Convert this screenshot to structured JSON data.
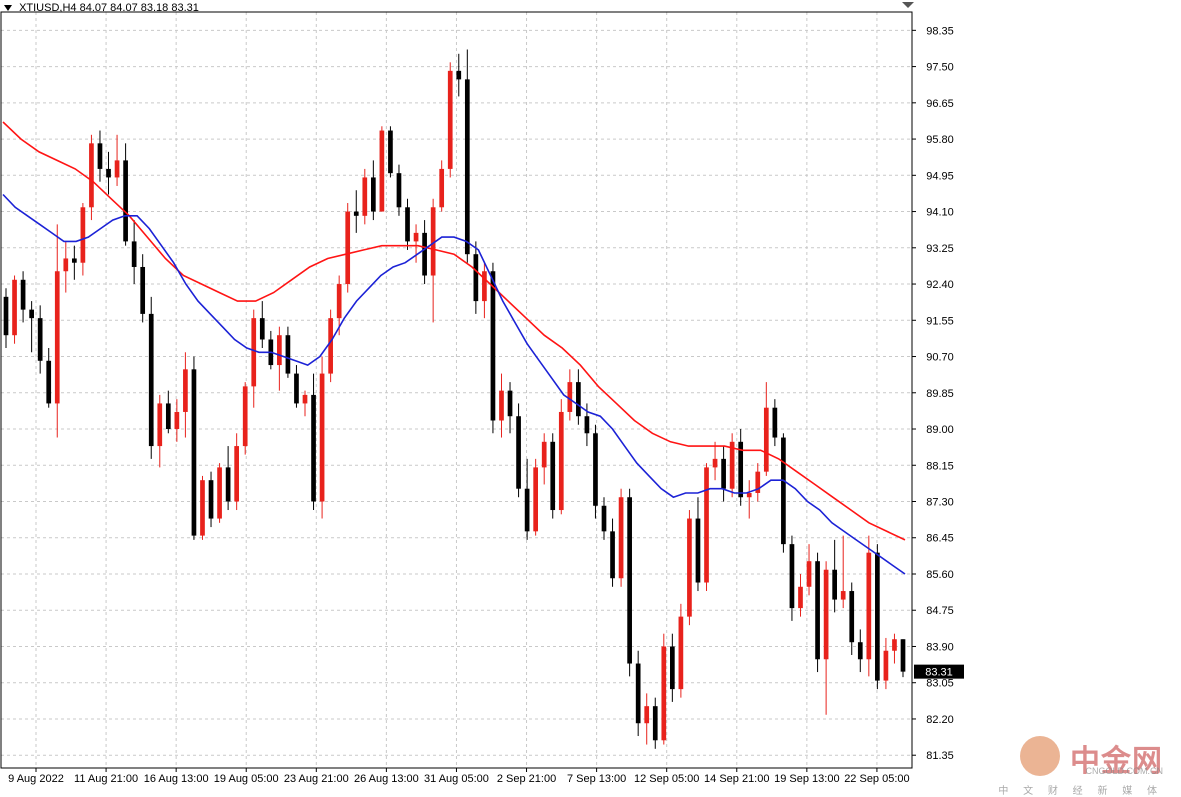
{
  "header": {
    "symbol": "XTIUSD,H4",
    "ohlc": "84.07 84.07 83.18 83.31"
  },
  "watermark": {
    "brand": "中金网",
    "site": "CNGOLD.COM.CN",
    "tagline": "中 文 财 经 新 媒 体"
  },
  "price_tag": "83.31",
  "colors": {
    "bull": "#e8221c",
    "bear": "#000000",
    "ma_fast": "#1c22d6",
    "ma_slow": "#ff1414",
    "grid": "#c9c9c9"
  },
  "chart_data": {
    "type": "candlestick",
    "symbol": "XTIUSD",
    "timeframe": "H4",
    "grid": true,
    "ylim": [
      81.05,
      98.78
    ],
    "y_ticks": [
      "98.35",
      "97.50",
      "96.65",
      "95.80",
      "94.95",
      "94.10",
      "93.25",
      "92.40",
      "91.55",
      "90.70",
      "89.85",
      "89.00",
      "88.15",
      "87.30",
      "86.45",
      "85.60",
      "84.75",
      "83.90",
      "83.05",
      "82.20",
      "81.35"
    ],
    "x_ticks": [
      "9 Aug 2022",
      "11 Aug 21:00",
      "16 Aug 13:00",
      "19 Aug 05:00",
      "23 Aug 21:00",
      "26 Aug 13:00",
      "31 Aug 05:00",
      "2 Sep 21:00",
      "7 Sep 13:00",
      "12 Sep 05:00",
      "14 Sep 21:00",
      "19 Sep 13:00",
      "22 Sep 05:00"
    ],
    "candles": [
      [
        92.1,
        92.3,
        90.9,
        91.2
      ],
      [
        91.2,
        92.6,
        91.0,
        92.5
      ],
      [
        92.5,
        92.7,
        91.5,
        91.8
      ],
      [
        91.8,
        92.0,
        90.8,
        91.6
      ],
      [
        91.6,
        91.9,
        90.3,
        90.6
      ],
      [
        90.6,
        90.9,
        89.5,
        89.6
      ],
      [
        89.6,
        93.8,
        88.8,
        92.7
      ],
      [
        92.7,
        93.4,
        92.2,
        93.0
      ],
      [
        93.0,
        93.3,
        92.5,
        92.9
      ],
      [
        92.9,
        94.3,
        92.6,
        94.2
      ],
      [
        94.2,
        95.9,
        93.9,
        95.7
      ],
      [
        95.7,
        96.0,
        94.8,
        95.1
      ],
      [
        95.1,
        95.5,
        94.5,
        94.9
      ],
      [
        94.9,
        95.9,
        94.7,
        95.3
      ],
      [
        95.3,
        95.7,
        93.3,
        93.4
      ],
      [
        93.4,
        93.9,
        92.4,
        92.8
      ],
      [
        92.8,
        93.1,
        91.5,
        91.7
      ],
      [
        91.7,
        92.1,
        88.3,
        88.6
      ],
      [
        88.6,
        89.8,
        88.1,
        89.6
      ],
      [
        89.6,
        89.9,
        88.9,
        89.0
      ],
      [
        89.0,
        89.7,
        88.7,
        89.4
      ],
      [
        89.4,
        90.8,
        88.8,
        90.4
      ],
      [
        90.4,
        90.7,
        86.4,
        86.5
      ],
      [
        86.5,
        87.9,
        86.4,
        87.8
      ],
      [
        87.8,
        88.0,
        86.7,
        86.9
      ],
      [
        86.9,
        88.2,
        86.8,
        88.1
      ],
      [
        88.1,
        88.6,
        87.1,
        87.3
      ],
      [
        87.3,
        88.9,
        87.1,
        88.6
      ],
      [
        88.6,
        90.1,
        88.4,
        90.0
      ],
      [
        90.0,
        91.8,
        89.5,
        91.6
      ],
      [
        91.6,
        92.0,
        90.9,
        91.1
      ],
      [
        91.1,
        91.3,
        90.4,
        90.5
      ],
      [
        90.5,
        91.4,
        89.9,
        91.2
      ],
      [
        91.2,
        91.4,
        90.2,
        90.3
      ],
      [
        90.3,
        90.5,
        89.5,
        89.6
      ],
      [
        89.6,
        89.9,
        89.3,
        89.8
      ],
      [
        89.8,
        90.3,
        87.1,
        87.3
      ],
      [
        87.3,
        90.7,
        86.9,
        90.3
      ],
      [
        90.3,
        91.8,
        90.1,
        91.6
      ],
      [
        91.6,
        92.6,
        91.2,
        92.4
      ],
      [
        92.4,
        94.3,
        92.2,
        94.1
      ],
      [
        94.1,
        94.6,
        93.6,
        94.0
      ],
      [
        94.0,
        95.1,
        93.8,
        94.9
      ],
      [
        94.9,
        95.3,
        93.9,
        94.1
      ],
      [
        94.1,
        96.1,
        94.1,
        96.0
      ],
      [
        96.0,
        96.1,
        94.9,
        95.0
      ],
      [
        95.0,
        95.2,
        94.0,
        94.2
      ],
      [
        94.2,
        94.4,
        93.2,
        93.4
      ],
      [
        93.4,
        93.8,
        92.9,
        93.6
      ],
      [
        93.6,
        93.9,
        92.4,
        92.6
      ],
      [
        92.6,
        94.4,
        91.5,
        94.2
      ],
      [
        94.2,
        95.3,
        94.1,
        95.1
      ],
      [
        95.1,
        97.6,
        94.9,
        97.4
      ],
      [
        97.4,
        97.8,
        96.8,
        97.2
      ],
      [
        97.2,
        97.9,
        92.9,
        93.1
      ],
      [
        93.1,
        93.4,
        91.7,
        92.0
      ],
      [
        92.0,
        92.9,
        91.6,
        92.7
      ],
      [
        92.7,
        92.9,
        88.9,
        89.2
      ],
      [
        89.2,
        90.3,
        88.8,
        89.9
      ],
      [
        89.9,
        90.1,
        88.9,
        89.3
      ],
      [
        89.3,
        89.6,
        87.4,
        87.6
      ],
      [
        87.6,
        88.3,
        86.4,
        86.6
      ],
      [
        86.6,
        88.3,
        86.5,
        88.1
      ],
      [
        88.1,
        88.9,
        87.7,
        88.7
      ],
      [
        88.7,
        88.9,
        86.9,
        87.1
      ],
      [
        87.1,
        89.7,
        87.0,
        89.4
      ],
      [
        89.4,
        90.4,
        89.2,
        90.1
      ],
      [
        90.1,
        90.4,
        89.1,
        89.3
      ],
      [
        89.3,
        89.6,
        88.6,
        88.9
      ],
      [
        88.9,
        89.1,
        86.9,
        87.2
      ],
      [
        87.2,
        87.4,
        86.4,
        86.6
      ],
      [
        86.6,
        86.9,
        85.3,
        85.5
      ],
      [
        85.5,
        87.6,
        85.3,
        87.4
      ],
      [
        87.4,
        87.6,
        83.2,
        83.5
      ],
      [
        83.5,
        83.8,
        81.8,
        82.1
      ],
      [
        82.1,
        82.8,
        81.6,
        82.5
      ],
      [
        82.5,
        82.7,
        81.5,
        81.7
      ],
      [
        81.7,
        84.2,
        81.6,
        83.9
      ],
      [
        83.9,
        84.2,
        82.6,
        82.9
      ],
      [
        82.9,
        84.9,
        82.7,
        84.6
      ],
      [
        84.6,
        87.1,
        84.4,
        86.9
      ],
      [
        86.9,
        87.4,
        85.2,
        85.4
      ],
      [
        85.4,
        88.2,
        85.2,
        88.1
      ],
      [
        88.1,
        88.7,
        87.8,
        88.3
      ],
      [
        88.3,
        88.6,
        87.3,
        87.6
      ],
      [
        87.6,
        88.9,
        87.4,
        88.7
      ],
      [
        88.7,
        89.0,
        87.2,
        87.4
      ],
      [
        87.4,
        87.8,
        86.9,
        87.5
      ],
      [
        87.5,
        88.2,
        87.3,
        88.0
      ],
      [
        88.0,
        90.1,
        87.9,
        89.5
      ],
      [
        89.5,
        89.7,
        88.6,
        88.8
      ],
      [
        88.8,
        88.9,
        86.1,
        86.3
      ],
      [
        86.3,
        86.5,
        84.5,
        84.8
      ],
      [
        84.8,
        85.6,
        84.6,
        85.3
      ],
      [
        85.3,
        86.3,
        85.1,
        85.9
      ],
      [
        85.9,
        86.1,
        83.3,
        83.6
      ],
      [
        83.6,
        85.9,
        82.3,
        85.7
      ],
      [
        85.7,
        86.4,
        84.7,
        85.0
      ],
      [
        85.0,
        86.5,
        84.8,
        85.2
      ],
      [
        85.2,
        85.4,
        83.7,
        84.0
      ],
      [
        84.0,
        84.3,
        83.3,
        83.6
      ],
      [
        83.6,
        86.5,
        83.2,
        86.1
      ],
      [
        86.1,
        86.3,
        82.9,
        83.1
      ],
      [
        83.1,
        84.1,
        82.9,
        83.8
      ],
      [
        83.8,
        84.2,
        83.5,
        84.07
      ],
      [
        84.07,
        84.07,
        83.18,
        83.31
      ]
    ],
    "ma_fast": {
      "color": "#1c22d6",
      "values": [
        94.5,
        94.2,
        94.0,
        93.8,
        93.6,
        93.4,
        93.4,
        93.5,
        93.7,
        93.9,
        94.0,
        94.0,
        93.7,
        93.3,
        92.9,
        92.4,
        92.0,
        91.7,
        91.4,
        91.1,
        90.9,
        90.8,
        90.8,
        90.7,
        90.6,
        90.5,
        90.7,
        91.1,
        91.6,
        92.0,
        92.3,
        92.6,
        92.8,
        92.9,
        93.1,
        93.3,
        93.5,
        93.5,
        93.4,
        93.2,
        92.6,
        92.0,
        91.5,
        91.0,
        90.6,
        90.2,
        89.8,
        89.6,
        89.4,
        89.3,
        89.0,
        88.6,
        88.2,
        87.9,
        87.6,
        87.4,
        87.5,
        87.5,
        87.6,
        87.6,
        87.5,
        87.5,
        87.6,
        87.8,
        87.8,
        87.6,
        87.3,
        87.1,
        86.8,
        86.6,
        86.4,
        86.2,
        86.0,
        85.8,
        85.6
      ]
    },
    "ma_slow": {
      "color": "#ff1414",
      "values": [
        96.2,
        95.8,
        95.5,
        95.3,
        95.1,
        94.8,
        94.4,
        94.0,
        93.5,
        93.0,
        92.6,
        92.4,
        92.2,
        92.0,
        92.0,
        92.2,
        92.5,
        92.8,
        93.0,
        93.1,
        93.2,
        93.3,
        93.3,
        93.3,
        93.2,
        93.1,
        92.8,
        92.4,
        92.0,
        91.6,
        91.2,
        90.9,
        90.5,
        90.0,
        89.6,
        89.2,
        88.9,
        88.7,
        88.6,
        88.6,
        88.6,
        88.5,
        88.5,
        88.3,
        88.0,
        87.7,
        87.4,
        87.1,
        86.8,
        86.6,
        86.4
      ]
    }
  }
}
